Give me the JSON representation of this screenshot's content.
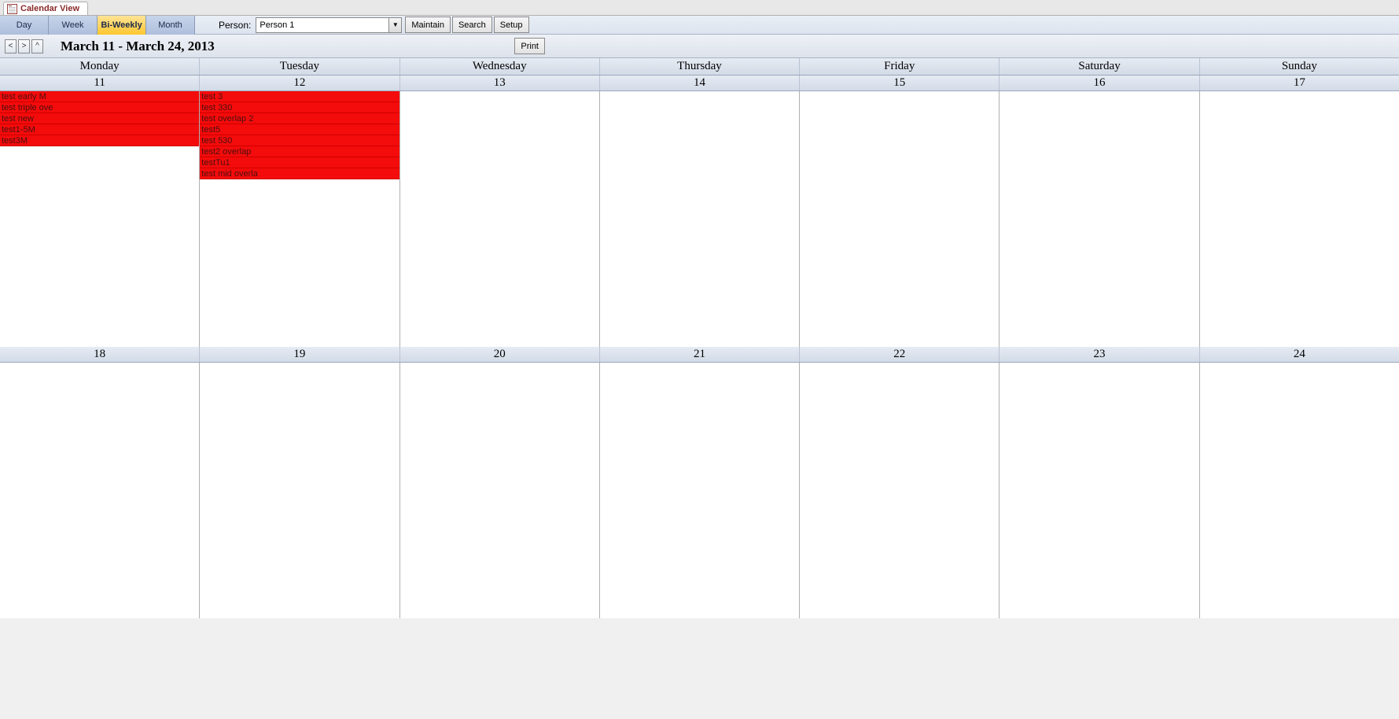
{
  "tab": {
    "title": "Calendar View"
  },
  "toolbar": {
    "views": [
      {
        "label": "Day",
        "active": false
      },
      {
        "label": "Week",
        "active": false
      },
      {
        "label": "Bi-Weekly",
        "active": true
      },
      {
        "label": "Month",
        "active": false
      }
    ],
    "person_label": "Person:",
    "person_value": "Person 1",
    "maintain": "Maintain",
    "search": "Search",
    "setup": "Setup"
  },
  "nav": {
    "prev": "<",
    "next": ">",
    "up": "^",
    "range": "March 11 - March 24, 2013",
    "print": "Print"
  },
  "day_headers": [
    "Monday",
    "Tuesday",
    "Wednesday",
    "Thursday",
    "Friday",
    "Saturday",
    "Sunday"
  ],
  "weeks": [
    {
      "dates": [
        "11",
        "12",
        "13",
        "14",
        "15",
        "16",
        "17"
      ],
      "days": [
        {
          "events": [
            "test early M",
            "test triple ove",
            "test new",
            "test1-5M",
            "test3M"
          ]
        },
        {
          "events": [
            "test 3",
            "test 330",
            "test overlap 2",
            "test5",
            "test 530",
            "test2 overlap",
            "testTu1",
            "test mid overla"
          ]
        },
        {
          "events": []
        },
        {
          "events": []
        },
        {
          "events": []
        },
        {
          "events": []
        },
        {
          "events": []
        }
      ]
    },
    {
      "dates": [
        "18",
        "19",
        "20",
        "21",
        "22",
        "23",
        "24"
      ],
      "days": [
        {
          "events": []
        },
        {
          "events": []
        },
        {
          "events": []
        },
        {
          "events": []
        },
        {
          "events": []
        },
        {
          "events": []
        },
        {
          "events": []
        }
      ]
    }
  ]
}
